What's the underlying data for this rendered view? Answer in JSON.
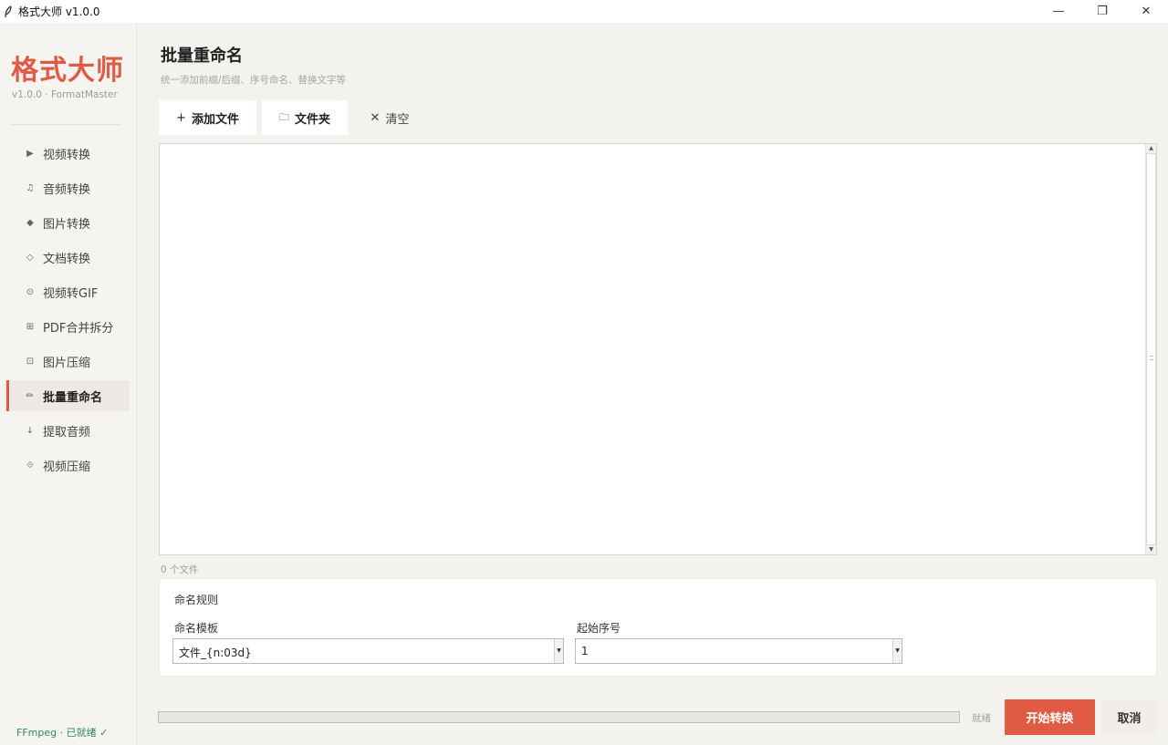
{
  "window": {
    "title": "格式大师 v1.0.0",
    "controls": {
      "minimize": "—",
      "restore": "❐",
      "close": "✕"
    }
  },
  "sidebar": {
    "brand": "格式大师",
    "version": "v1.0.0 · FormatMaster",
    "items": [
      {
        "icon": "▶",
        "icon_name": "play-icon",
        "label": "视频转换"
      },
      {
        "icon": "♫",
        "icon_name": "music-note-icon",
        "label": "音频转换"
      },
      {
        "icon": "◆",
        "icon_name": "diamond-icon",
        "label": "图片转换"
      },
      {
        "icon": "◇",
        "icon_name": "outline-diamond-icon",
        "label": "文档转换"
      },
      {
        "icon": "⊙",
        "icon_name": "circle-dot-icon",
        "label": "视频转GIF"
      },
      {
        "icon": "⊞",
        "icon_name": "grid-square-icon",
        "label": "PDF合并拆分"
      },
      {
        "icon": "⊡",
        "icon_name": "square-dot-icon",
        "label": "图片压缩"
      },
      {
        "icon": "✏",
        "icon_name": "pencil-icon",
        "label": "批量重命名"
      },
      {
        "icon": "↓",
        "icon_name": "down-arrow-icon",
        "label": "提取音频"
      },
      {
        "icon": "⟐",
        "icon_name": "diamond-dot-icon",
        "label": "视频压缩"
      }
    ],
    "active_index": 7,
    "ffmpeg_status": "FFmpeg · 已就绪 ✓"
  },
  "main": {
    "title": "批量重命名",
    "subtitle": "统一添加前缀/后缀、序号命名、替换文字等",
    "toolbar": {
      "add_icon": "+",
      "add_files": "添加文件",
      "folder_icon": "🗀",
      "folder": "文件夹",
      "clear_icon": "✕",
      "clear": "清空"
    },
    "file_count": "0 个文件",
    "rules": {
      "title": "命名规则",
      "template_label": "命名模板",
      "template_value": "文件_{n:03d}",
      "start_label": "起始序号",
      "start_value": "1"
    },
    "progress": 0,
    "status": "就绪",
    "start_button": "开始转换",
    "cancel_button": "取消"
  },
  "colors": {
    "accent": "#e05a44",
    "sidebar_bg": "#f6f4f1",
    "page_bg": "#f4f2ef",
    "success": "#2e8b57"
  }
}
